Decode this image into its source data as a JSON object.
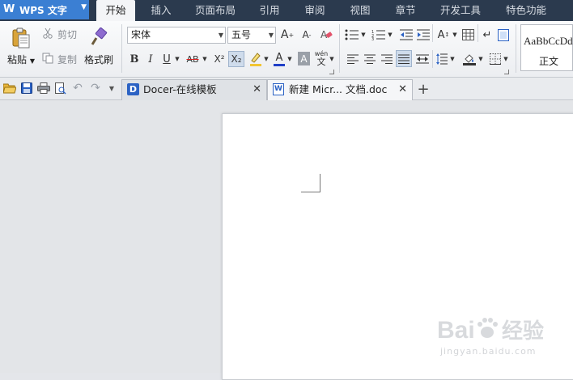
{
  "app": {
    "name": "WPS 文字",
    "logo_char": "W"
  },
  "menu_tabs": [
    "开始",
    "插入",
    "页面布局",
    "引用",
    "审阅",
    "视图",
    "章节",
    "开发工具",
    "特色功能"
  ],
  "active_tab_index": 0,
  "clipboard": {
    "paste": "粘贴",
    "cut": "剪切",
    "copy": "复制",
    "format_painter": "格式刷"
  },
  "font": {
    "family": "宋体",
    "size": "五号"
  },
  "format_buttons": {
    "bold": "B",
    "italic": "I",
    "underline": "U",
    "strikethrough": "AB",
    "superscript": "X²",
    "subscript": "X₂",
    "font_color": "A",
    "char_shading": "A",
    "phonetic": "wén"
  },
  "styles": {
    "preview": "AaBbCcDd",
    "name": "正文"
  },
  "doc_tabs": [
    {
      "label": "Docer-在线模板",
      "icon": "docer-icon"
    },
    {
      "label": "新建 Micr... 文档.doc",
      "icon": "word-doc-icon"
    }
  ],
  "active_doc_tab": 1,
  "new_tab": "+",
  "watermark": {
    "brand": "Bai",
    "brand2": "经验",
    "url": "jingyan.baidu.com"
  },
  "colors": {
    "titlebar": "#2b3a4e",
    "app_button": "#3b7fd3",
    "highlight": "#f2c531",
    "font_color": "#1f3fc7"
  }
}
